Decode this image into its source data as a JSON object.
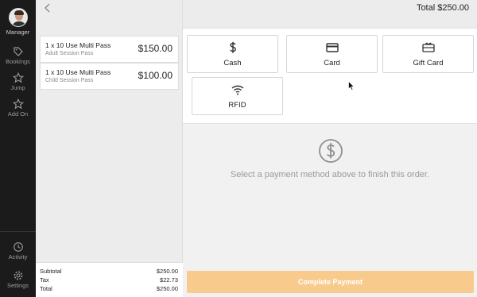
{
  "nav": {
    "user_label": "Manager",
    "items": [
      {
        "label": "Bookings",
        "icon": "tag-icon"
      },
      {
        "label": "Jump",
        "icon": "star-icon"
      },
      {
        "label": "Add On",
        "icon": "star-outline-icon"
      },
      {
        "label": "Activity",
        "icon": "clock-icon"
      },
      {
        "label": "Settings",
        "icon": "gear-icon"
      }
    ]
  },
  "header": {
    "total_text": "Total $250.00"
  },
  "cart": {
    "lines": [
      {
        "name": "1 x 10 Use Multi Pass",
        "sub": "Adult Session Pass",
        "price": "$150.00"
      },
      {
        "name": "1 x 10 Use Multi Pass",
        "sub": "Child Session Pass",
        "price": "$100.00"
      }
    ],
    "totals": {
      "subtotal_label": "Subtotal",
      "subtotal_value": "$250.00",
      "tax_label": "Tax",
      "tax_value": "$22.73",
      "total_label": "Total",
      "total_value": "$250.00"
    }
  },
  "payment_methods": [
    {
      "label": "Cash",
      "icon": "dollar-icon"
    },
    {
      "label": "Card",
      "icon": "credit-card-icon"
    },
    {
      "label": "Gift Card",
      "icon": "gift-card-icon"
    },
    {
      "label": "RFID",
      "icon": "wifi-icon"
    }
  ],
  "empty_state": {
    "message": "Select a payment method above to finish this order."
  },
  "actions": {
    "complete_label": "Complete Payment"
  },
  "colors": {
    "rail_bg": "#1b1b1b",
    "complete_button": "#f8cb8d",
    "panel_bg": "#f1f1f1"
  }
}
